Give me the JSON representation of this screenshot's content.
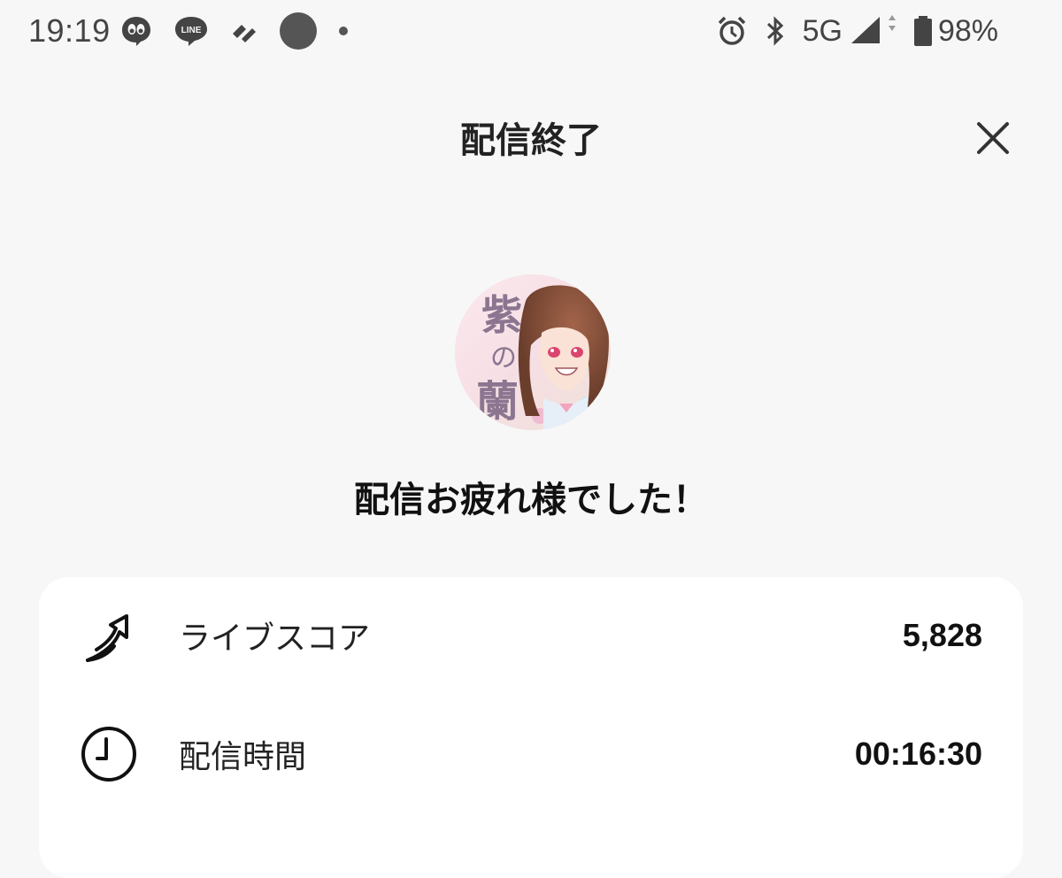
{
  "status_bar": {
    "time": "19:19",
    "notification_icons": [
      "eyes-app-icon",
      "line-app-icon",
      "app-icon",
      "circle-app-icon",
      "more-dot-icon"
    ],
    "line_badge_text": "LINE",
    "network": "5G",
    "battery": "98%",
    "right_icons": [
      "alarm-icon",
      "bluetooth-icon",
      "signal-icon",
      "battery-icon"
    ]
  },
  "header": {
    "title": "配信終了",
    "close_icon": "close-icon"
  },
  "avatar": {
    "overlay_text": "紫の蘭"
  },
  "greeting": "配信お疲れ様でした！",
  "stats": [
    {
      "icon": "live-score-icon",
      "label": "ライブスコア",
      "value": "5,828"
    },
    {
      "icon": "clock-icon",
      "label": "配信時間",
      "value": "00:16:30"
    }
  ],
  "colors": {
    "background": "#f7f7f7",
    "card": "#ffffff",
    "text": "#111111"
  }
}
